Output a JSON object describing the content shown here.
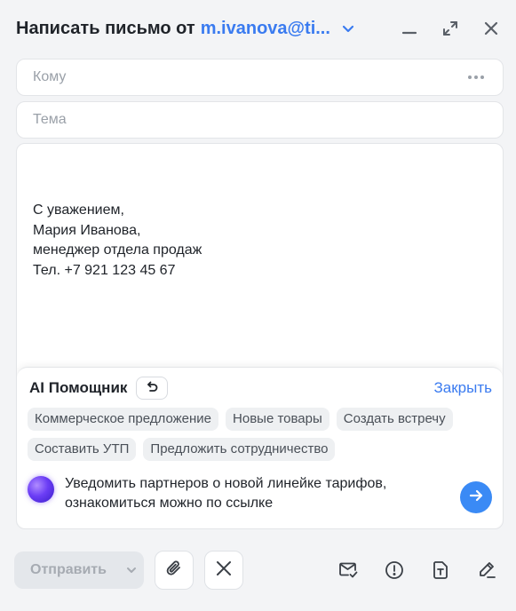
{
  "header": {
    "title": "Написать письмо от",
    "from_email": "m.ivanova@ti..."
  },
  "fields": {
    "to_placeholder": "Кому",
    "subject_placeholder": "Тема"
  },
  "signature": {
    "line1": "С уважением,",
    "line2": "Мария Иванова,",
    "line3": "менеджер отдела продаж",
    "line4": "Тел. +7 921 123 45 67"
  },
  "ai": {
    "title": "AI Помощник",
    "close_label": "Закрыть",
    "chips": [
      "Коммерческое предложение",
      "Новые товары",
      "Создать встречу",
      "Составить УТП",
      "Предложить сотрудничество"
    ],
    "prompt": "Уведомить партнеров о новой линейке тарифов, ознакомиться можно по ссылке"
  },
  "footer": {
    "send_label": "Отправить"
  },
  "colors": {
    "accent": "#3a7bf0",
    "send_button": "#3a8af5",
    "chip_bg": "#eef0f2"
  },
  "icons": [
    "chevron-down-icon",
    "minimize-icon",
    "expand-icon",
    "close-icon",
    "more-dots-icon",
    "undo-icon",
    "arrow-right-icon",
    "paperclip-icon",
    "discard-icon",
    "read-receipt-icon",
    "importance-icon",
    "template-icon",
    "signature-icon"
  ]
}
